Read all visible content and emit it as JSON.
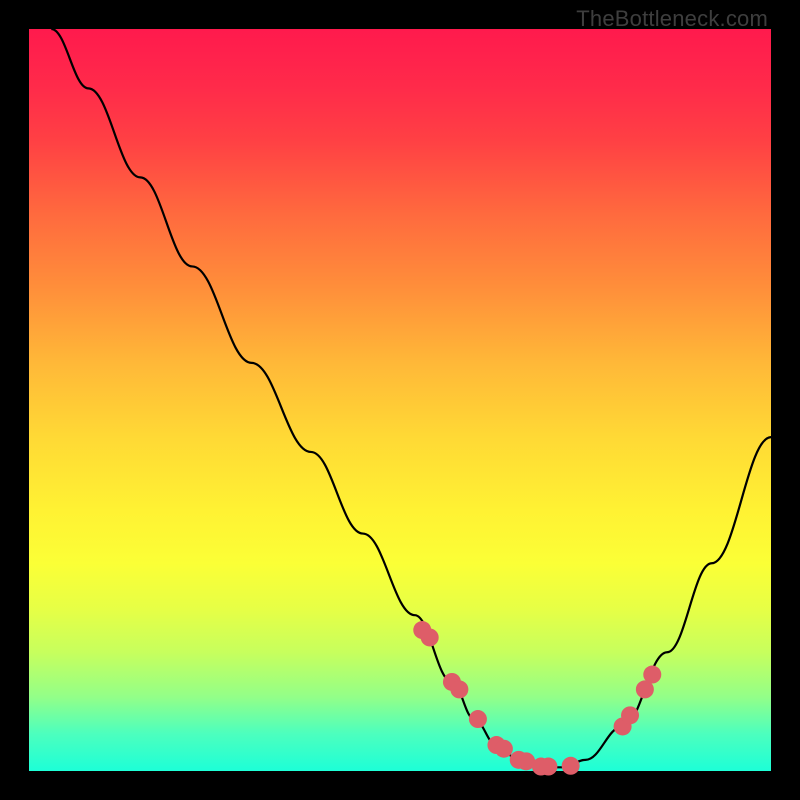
{
  "watermark": "TheBottleneck.com",
  "chart_data": {
    "type": "line",
    "title": "",
    "xlabel": "",
    "ylabel": "",
    "xlim": [
      0,
      100
    ],
    "ylim": [
      0,
      100
    ],
    "series": [
      {
        "name": "bottleneck-curve",
        "x": [
          3,
          8,
          15,
          22,
          30,
          38,
          45,
          52,
          57,
          60,
          63,
          66,
          69,
          72,
          75,
          80,
          86,
          92,
          100
        ],
        "values": [
          100,
          92,
          80,
          68,
          55,
          43,
          32,
          21,
          12,
          7,
          3.5,
          1.5,
          0.5,
          0.5,
          1.5,
          6,
          16,
          28,
          45
        ]
      }
    ],
    "markers": {
      "name": "optimal-points",
      "color": "#de5d68",
      "radius": 9,
      "x": [
        53,
        54,
        57,
        58,
        60.5,
        63,
        64,
        66,
        67,
        69,
        70,
        73,
        80,
        81,
        83,
        84
      ],
      "values": [
        19,
        18,
        12,
        11,
        7,
        3.5,
        3,
        1.5,
        1.3,
        0.6,
        0.6,
        0.7,
        6,
        7.5,
        11,
        13
      ]
    },
    "gradient_stops": [
      {
        "pos": 0,
        "color": "#ff1a4d"
      },
      {
        "pos": 50,
        "color": "#ffe534"
      },
      {
        "pos": 100,
        "color": "#1dffd7"
      }
    ]
  }
}
